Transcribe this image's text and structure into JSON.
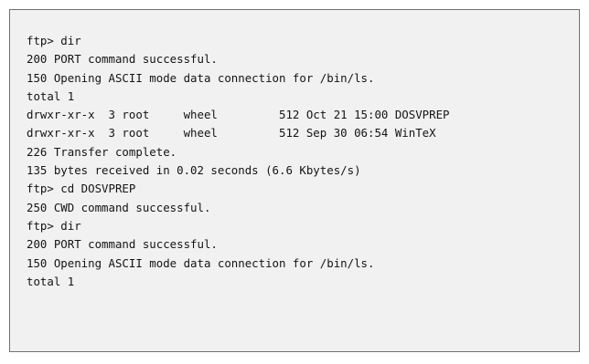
{
  "terminal": {
    "lines": [
      "ftp> dir",
      "200 PORT command successful.",
      "150 Opening ASCII mode data connection for /bin/ls.",
      "total 1",
      "drwxr-xr-x  3 root     wheel         512 Oct 21 15:00 DOSVPREP",
      "drwxr-xr-x  3 root     wheel         512 Sep 30 06:54 WinTeX",
      "226 Transfer complete.",
      "135 bytes received in 0.02 seconds (6.6 Kbytes/s)",
      "ftp> cd DOSVPREP",
      "250 CWD command successful.",
      "ftp> dir",
      "200 PORT command successful.",
      "150 Opening ASCII mode data connection for /bin/ls.",
      "total 1"
    ]
  },
  "colors": {
    "panel_background": "#f1f1f1",
    "panel_border": "#6f6f6f",
    "text": "#141414"
  }
}
